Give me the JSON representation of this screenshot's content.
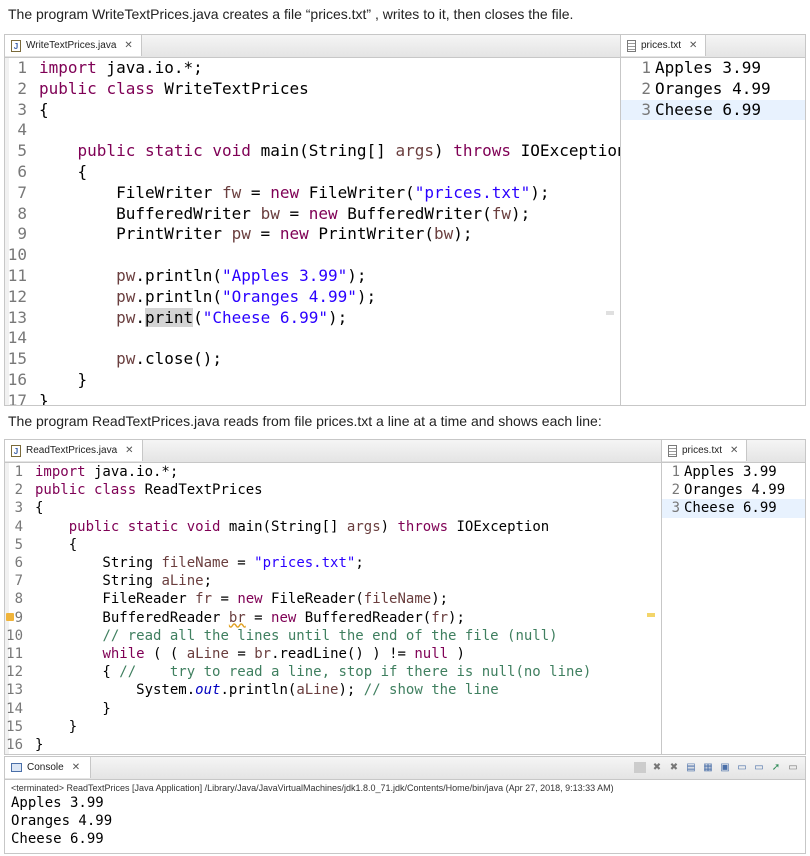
{
  "caption1": "The program WriteTextPrices.java creates a file “prices.txt” , writes to it, then closes the file.",
  "caption2": "The program ReadTextPrices.java reads from file prices.txt a line at a time and shows each line:",
  "write_editor": {
    "tab": "WriteTextPrices.java",
    "numbers": [
      "1",
      "2",
      "3",
      "4",
      "5",
      "6",
      "7",
      "8",
      "9",
      "10",
      "11",
      "12",
      "13",
      "14",
      "15",
      "16",
      "17"
    ]
  },
  "prices_tab": "prices.txt",
  "prices_lines": [
    "Apples 3.99",
    "Oranges 4.99",
    "Cheese 6.99"
  ],
  "read_editor": {
    "tab": "ReadTextPrices.java",
    "numbers": [
      "1",
      "2",
      "3",
      "4",
      "5",
      "6",
      "7",
      "8",
      "9",
      "10",
      "11",
      "12",
      "13",
      "14",
      "15",
      "16"
    ]
  },
  "console": {
    "tab": "Console",
    "terminated": "<terminated> ReadTextPrices [Java Application] /Library/Java/JavaVirtualMachines/jdk1.8.0_71.jdk/Contents/Home/bin/java (Apr 27, 2018, 9:13:33 AM)",
    "output": [
      "Apples 3.99",
      "Oranges 4.99",
      "Cheese 6.99"
    ]
  },
  "icons": {
    "java_file": "java-file-icon",
    "text_file": "text-file-icon",
    "close": "close-icon",
    "console": "console-icon"
  },
  "colors": {
    "keyword": "#7f0055",
    "string": "#2a00ff",
    "comment": "#3f7f5f",
    "static_field": "#0000c0",
    "current_line": "#e8f2fe"
  }
}
